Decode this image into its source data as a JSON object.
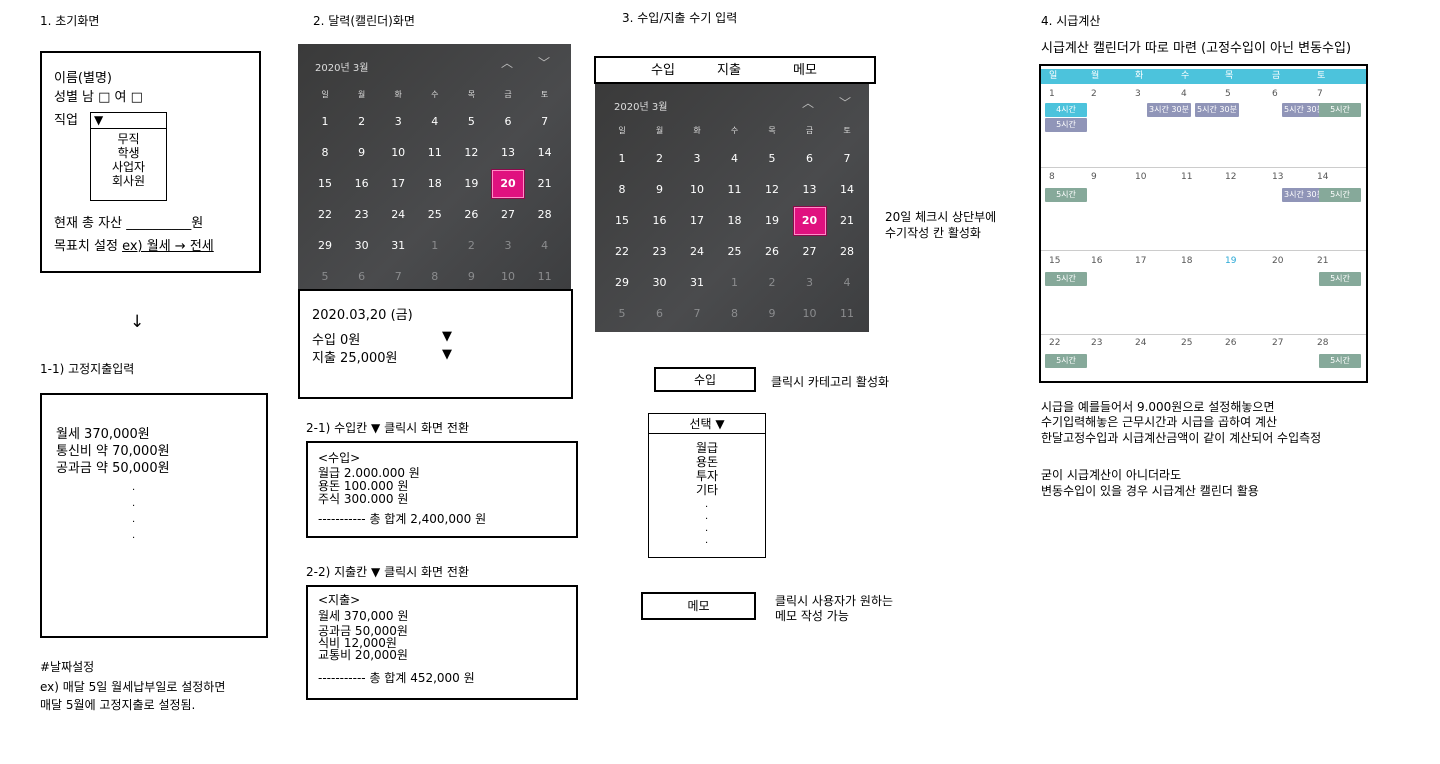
{
  "s1": {
    "title": "1. 초기화면",
    "name_label": "이름(별명)",
    "gender_label": "성별 남 □ 여 □",
    "job_label": "직업",
    "job_select": "▼",
    "job_options": [
      "무직",
      "학생",
      "사업자",
      "회사원"
    ],
    "assets_label": "현재 총 자산 __________원",
    "goal_prefix": "목표치 설정 ",
    "goal_example": "ex) 월세 → 전세",
    "arrow": "↓",
    "fixed_title": "1-1) 고정지출입력",
    "fixed_items": [
      "월세 370,000원",
      "통신비 약 70,000원",
      "공과금 약 50,000원"
    ],
    "note_title": "#날짜설정",
    "note_lines": [
      "ex) 매달 5일 월세납부일로 설정하면",
      "매달 5월에 고정지출로 설정됨."
    ]
  },
  "s2": {
    "title": "2. 달력(캘린더)화면",
    "cal_header": "2020년 3월",
    "nav_up": "︿",
    "nav_down": "﹀",
    "dow": [
      "일",
      "월",
      "화",
      "수",
      "목",
      "금",
      "토"
    ],
    "weeks": [
      [
        "1",
        "2",
        "3",
        "4",
        "5",
        "6",
        "7"
      ],
      [
        "8",
        "9",
        "10",
        "11",
        "12",
        "13",
        "14"
      ],
      [
        "15",
        "16",
        "17",
        "18",
        "19",
        "20",
        "21"
      ],
      [
        "22",
        "23",
        "24",
        "25",
        "26",
        "27",
        "28"
      ],
      [
        "29",
        "30",
        "31",
        "1",
        "2",
        "3",
        "4"
      ],
      [
        "5",
        "6",
        "7",
        "8",
        "9",
        "10",
        "11"
      ]
    ],
    "selected_day": "20",
    "date_line": "2020.03,20 (금)",
    "income_line": "수입 0원",
    "expense_line": "지출 25,000원",
    "dropdown_arrow": "▼",
    "income_title": "2-1) 수입칸 ▼ 클릭시 화면 전환",
    "income_box": [
      "<수입>",
      "월급 2.000.000 원",
      "용돈 100.000 원",
      "주식 300.000 원"
    ],
    "income_total": "----------- 총 합계 2,400,000 원",
    "expense_title": "2-2) 지출칸 ▼ 클릭시 화면 전환",
    "expense_box": [
      "<지출>",
      "월세 370,000 원",
      "공과금 50,000원",
      "식비 12,000원",
      "교통비 20,000원"
    ],
    "expense_total": "----------- 총 합계 452,000 원"
  },
  "s3": {
    "title": "3. 수입/지출 수기 입력",
    "tabs": [
      "수입",
      "지출",
      "메모"
    ],
    "cal_header": "2020년 3월",
    "selected_day": "20",
    "side_note": [
      "20일 체크시 상단부에",
      "수기작성 칸 활성화"
    ],
    "income_button": "수입",
    "income_note": "클릭시 카테고리 활성화",
    "select_label": "선택 ▼",
    "categories": [
      "월급",
      "용돈",
      "투자",
      "기타"
    ],
    "memo_button": "메모",
    "memo_note": [
      "클릭시 사용자가 원하는",
      "메모 작성 가능"
    ]
  },
  "s4": {
    "title": "4. 시급계산",
    "subtitle": "시급계산 캘린더가 따로 마련 (고정수입이 아닌 변동수입)",
    "dow": [
      "일",
      "월",
      "화",
      "수",
      "목",
      "금",
      "토"
    ],
    "weeks": [
      [
        "1",
        "2",
        "3",
        "4",
        "5",
        "6",
        "7"
      ],
      [
        "8",
        "9",
        "10",
        "11",
        "12",
        "13",
        "14"
      ],
      [
        "15",
        "16",
        "17",
        "18",
        "19",
        "20",
        "21"
      ],
      [
        "22",
        "23",
        "24",
        "25",
        "26",
        "27",
        "28"
      ]
    ],
    "today": "19",
    "pills": {
      "p4h": "4시간",
      "p5h": "5시간",
      "p330a": "3시간 30분",
      "p530a": "5시간 30분"
    },
    "colors": {
      "cyan": "#4cc3dc",
      "lavender": "#9095b8",
      "green": "#86a99a"
    },
    "note1": [
      "시급을 예를들어서 9.000원으로 설정해놓으면",
      "수기입력해놓은 근무시간과 시급을 곱하여 계산",
      "한달고정수입과 시급계산금액이 같이 계산되어 수입측정"
    ],
    "note2": [
      "굳이 시급계산이 아니더라도",
      "변동수입이 있을 경우 시급계산 캘린더 활용"
    ]
  }
}
